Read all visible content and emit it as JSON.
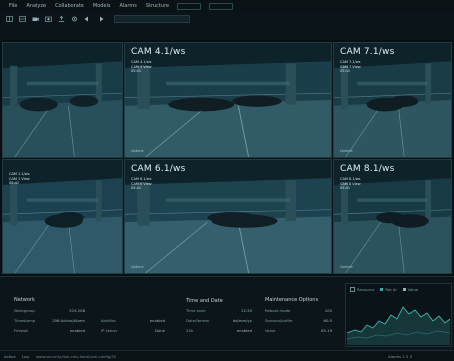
{
  "menubar": {
    "items": [
      "File",
      "Analyze",
      "Collaborate",
      "Models",
      "Alarms",
      "Structure"
    ],
    "buttons": [
      "",
      ""
    ]
  },
  "toolbar": {
    "icons": [
      "grid-icon",
      "layout-icon",
      "camera-icon",
      "snapshot-icon",
      "export-icon",
      "settings-icon",
      "back-icon",
      "forward-icon"
    ]
  },
  "cameras": [
    {
      "id": "cam-main",
      "title": "",
      "info": [],
      "foot": "",
      "foot2": ""
    },
    {
      "id": "cam-4",
      "title": "CAM 4.1/ws",
      "info": [
        "CAM 4.1/ws",
        "CAM 4 View",
        "05:41"
      ],
      "foot": "Uptime",
      "foot2": ""
    },
    {
      "id": "cam-7",
      "title": "CAM 7.1/ws",
      "info": [
        "CAM 7.1/ws",
        "CAM 7 View",
        "05:41"
      ],
      "foot": "Uptime",
      "foot2": ""
    },
    {
      "id": "cam-left",
      "title": "",
      "info": [
        "CAM 1.1/ws",
        "CAM 1 View",
        "05:41"
      ],
      "foot": "",
      "foot2": ""
    },
    {
      "id": "cam-6",
      "title": "CAM 6.1/ws",
      "info": [
        "CAM 6.1/ws",
        "CAM 6 View",
        "05:41"
      ],
      "foot": "Uptime",
      "foot2": ""
    },
    {
      "id": "cam-8",
      "title": "CAM 8.1/ws",
      "info": [
        "CAM 8.1/ws",
        "CAM 8 View",
        "05:41"
      ],
      "foot": "Uptime",
      "foot2": ""
    }
  ],
  "bottom": {
    "network": {
      "title": "Network",
      "rows": [
        {
          "label": "Workgroup",
          "value": "519.208"
        },
        {
          "label": "Timestamp",
          "value": "256 Active/Alarm"
        },
        {
          "label": "Firewall",
          "value": "enabled"
        }
      ],
      "rows2": [
        {
          "label": "AdvMac",
          "value": "enabled"
        },
        {
          "label": "IP status",
          "value": "Done"
        }
      ]
    },
    "time": {
      "title": "Time and Date",
      "rows": [
        {
          "label": "Time zone",
          "value": "12:30"
        },
        {
          "label": "Date/format",
          "value": "dd/mm/yy"
        },
        {
          "label": "24h",
          "value": "enabled"
        }
      ]
    },
    "maint": {
      "title": "Maintenance Options",
      "rows": [
        {
          "label": "Reboot mode",
          "value": "100"
        },
        {
          "label": "Sensors/buffer",
          "value": "60.0"
        },
        {
          "label": "Value",
          "value": "65.19"
        }
      ]
    },
    "chart": {
      "legend": [
        "Resource",
        "Ret Al",
        "Value"
      ],
      "legend_colors": [
        "#6a8c92",
        "#3fa7a0",
        "#83b9c0"
      ],
      "line_color": "#3fb7ad"
    }
  },
  "status": {
    "left": "Active",
    "left2": "Log",
    "path": "www.security/live.cms.feed/cam.config/32",
    "right": "Alarms 1  2  3"
  }
}
